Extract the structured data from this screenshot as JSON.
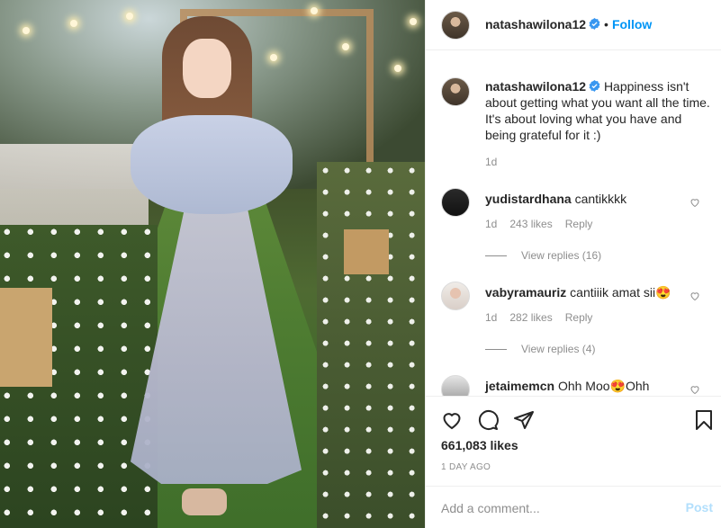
{
  "post": {
    "username": "natashawilona12",
    "follow_label": "Follow",
    "separator": "•",
    "caption": "Happiness isn't about getting what you want all the time. It's about loving what you have and being grateful for it :)",
    "caption_time": "1d",
    "likes": "661,083 likes",
    "date": "1 DAY AGO"
  },
  "comments": [
    {
      "username": "yudistardhana",
      "text": "cantikkkk",
      "time": "1d",
      "likes": "243 likes",
      "reply": "Reply",
      "view_replies": "View replies (16)"
    },
    {
      "username": "vabyramauriz",
      "text": "cantiiik amat sii😍",
      "time": "1d",
      "likes": "282 likes",
      "reply": "Reply",
      "view_replies": "View replies (4)"
    },
    {
      "username": "jetaimemcn",
      "text": "Ohh Moo😍Ohh"
    }
  ],
  "add_comment": {
    "placeholder": "Add a comment...",
    "post_label": "Post"
  },
  "icons": {
    "verified": "verified-badge-icon",
    "like": "heart-icon",
    "comment": "comment-icon",
    "share": "share-icon",
    "save": "bookmark-icon"
  },
  "colors": {
    "accent": "#0095f6",
    "verified": "#3897f0",
    "muted": "#8e8e8e",
    "post_disabled": "#b2dffc"
  }
}
